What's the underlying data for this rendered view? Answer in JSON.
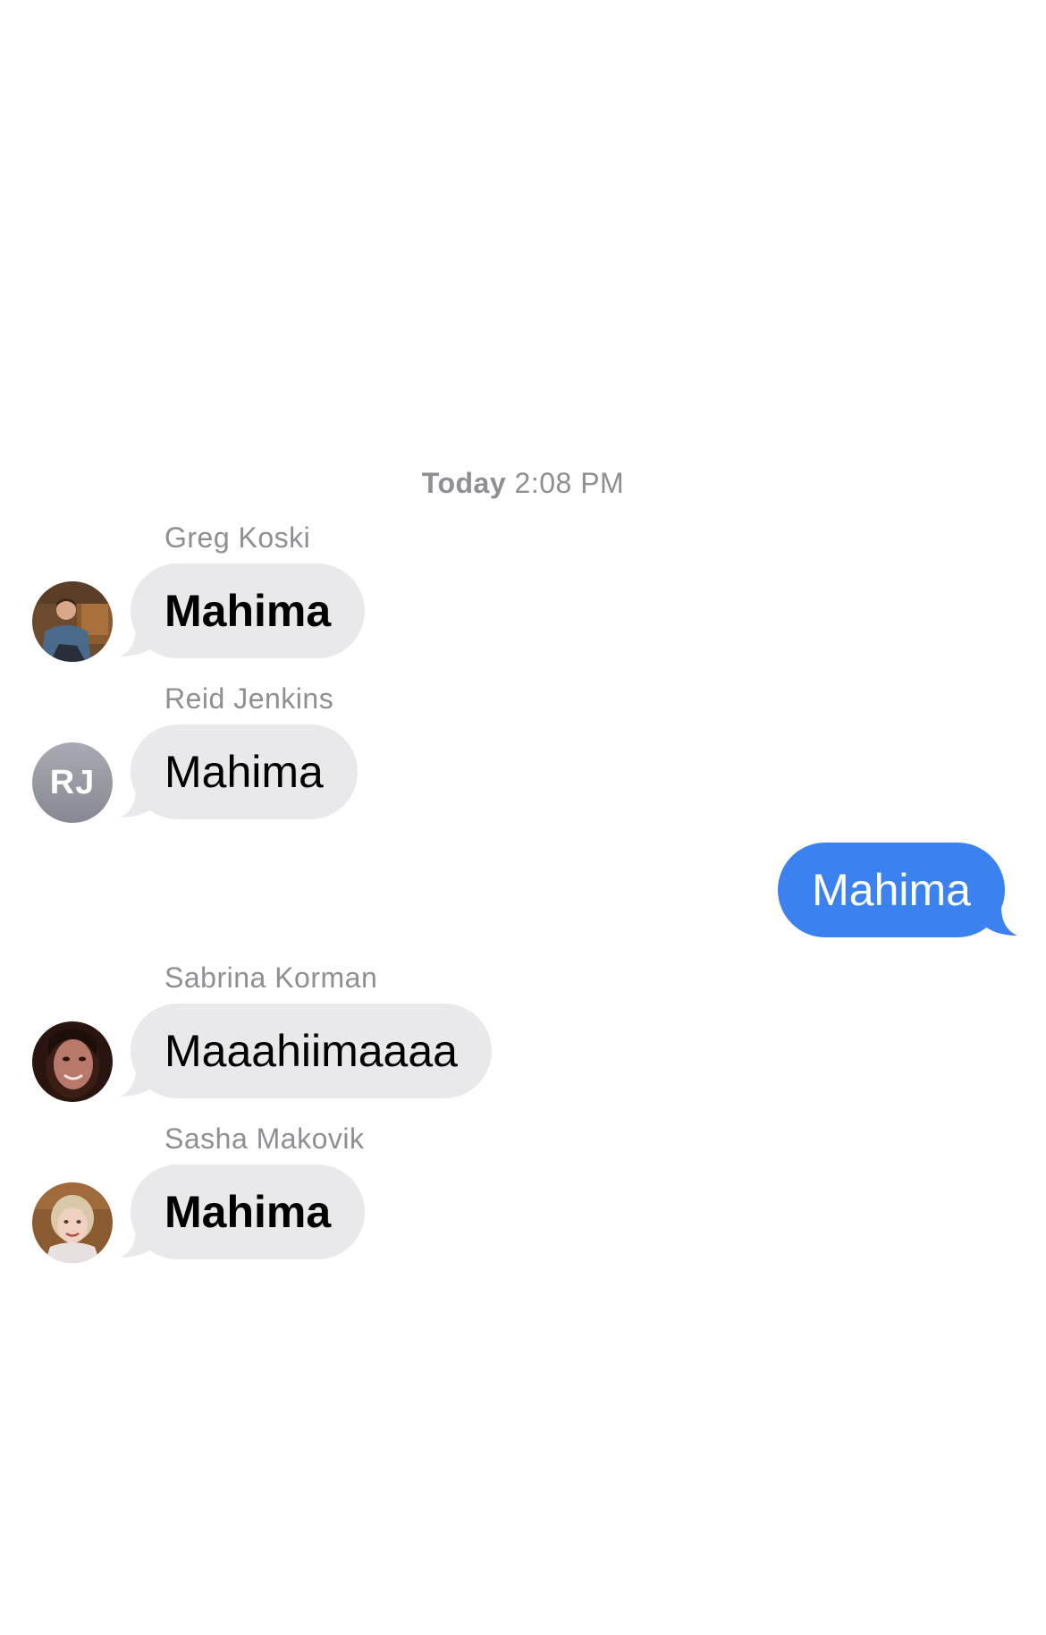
{
  "conversation": {
    "timestamp": {
      "day": "Today",
      "time": "2:08 PM"
    },
    "messages": [
      {
        "sender": "Greg Koski",
        "text": "Mahima",
        "direction": "incoming",
        "avatar": "photo-man-icon"
      },
      {
        "sender": "Reid Jenkins",
        "text": "Mahima",
        "direction": "incoming",
        "avatar_initials": "RJ"
      },
      {
        "text": "Mahima",
        "direction": "outgoing"
      },
      {
        "sender": "Sabrina Korman",
        "text": "Maaahiimaaaa",
        "direction": "incoming",
        "avatar": "photo-woman-icon"
      },
      {
        "sender": "Sasha Makovik",
        "text": "Mahima",
        "direction": "incoming",
        "avatar": "photo-woman-blonde-icon"
      }
    ]
  },
  "colors": {
    "incoming_bubble": "#e9e9eb",
    "outgoing_bubble": "#3b82f0",
    "meta_text": "#8e8e93"
  }
}
